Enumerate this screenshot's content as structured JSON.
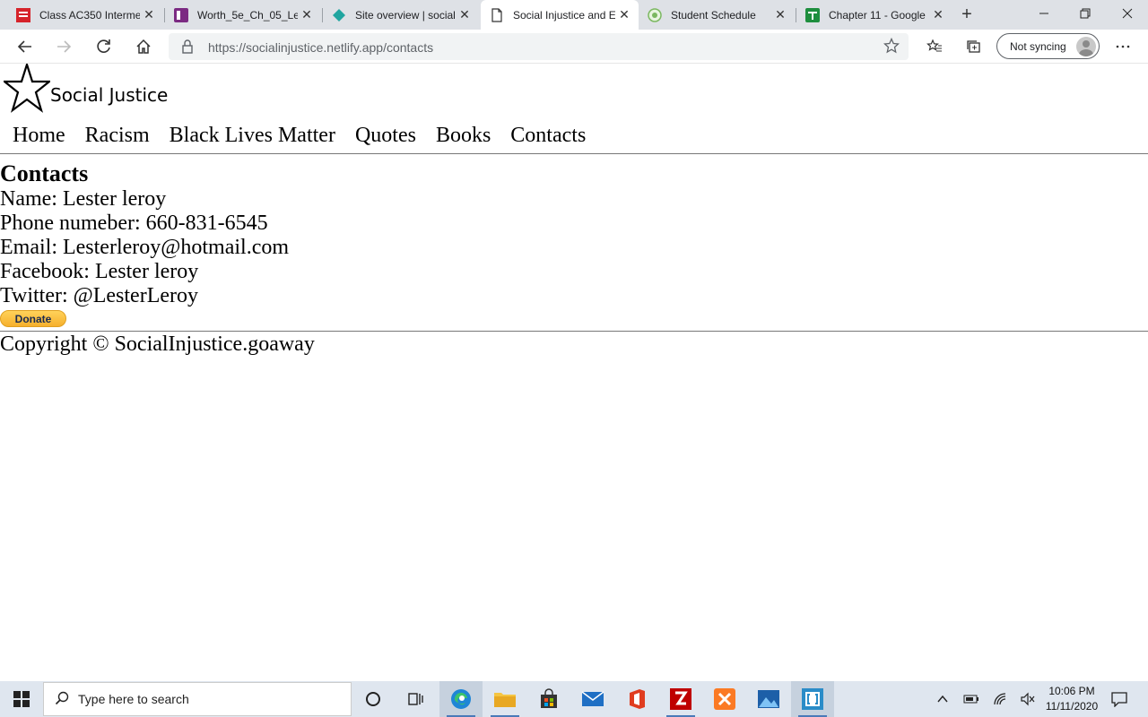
{
  "browser": {
    "tabs": [
      {
        "title": "Class AC350 Interme",
        "icon": "mcgraw-hill-icon"
      },
      {
        "title": "Worth_5e_Ch_05_Lea",
        "icon": "onenote-icon"
      },
      {
        "title": "Site overview | social",
        "icon": "netlify-icon"
      },
      {
        "title": "Social Injustice and E",
        "icon": "page-icon",
        "active": true
      },
      {
        "title": "Student Schedule",
        "icon": "schedule-icon"
      },
      {
        "title": "Chapter 11 - Google",
        "icon": "google-sheets-icon"
      }
    ],
    "url": "https://socialinjustice.netlify.app/contacts",
    "sync_label": "Not syncing"
  },
  "page": {
    "brand": "Social Justice",
    "nav": [
      "Home",
      "Racism",
      "Black Lives Matter",
      "Quotes",
      "Books",
      "Contacts"
    ],
    "contacts": {
      "heading": "Contacts",
      "name": "Name: Lester leroy",
      "phone": "Phone numeber: 660-831-6545",
      "email": "Email: Lesterleroy@hotmail.com",
      "facebook": "Facebook: Lester leroy",
      "twitter": "Twitter: @LesterLeroy"
    },
    "donate_label": "Donate",
    "footer": "Copyright © SocialInjustice.goaway"
  },
  "taskbar": {
    "search_placeholder": "Type here to search",
    "time": "10:06 PM",
    "date": "11/11/2020"
  }
}
